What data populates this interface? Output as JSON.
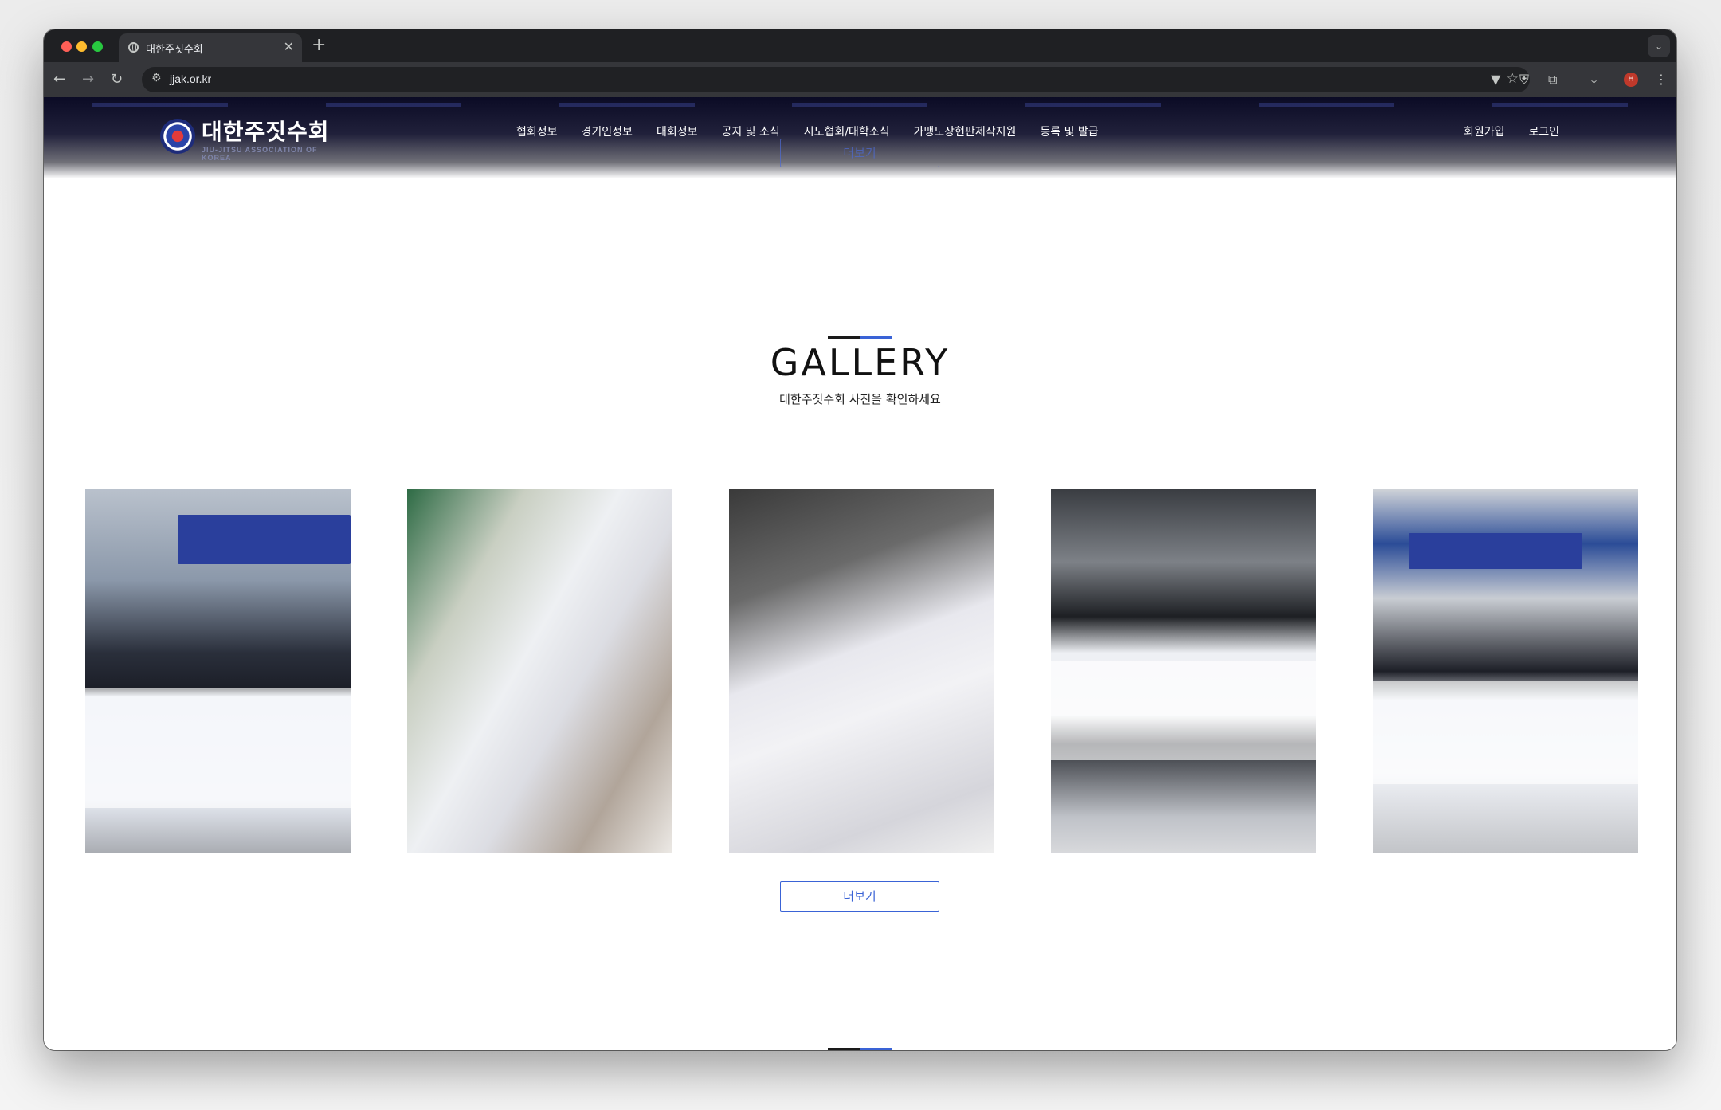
{
  "browser": {
    "tab_title": "대한주짓수회",
    "url": "jjak.or.kr",
    "profile_initial": "H"
  },
  "header": {
    "logo_text": "대한주짓수회",
    "logo_sub": "JIU-JITSU ASSOCIATION OF KOREA",
    "nav": [
      "협회정보",
      "경기인정보",
      "대회정보",
      "공지 및 소식",
      "시도협회/대학소식",
      "가맹도장현판제작지원",
      "등록 및 발급"
    ],
    "signup": "회원가입",
    "login": "로그인",
    "ghost_more_label": "더보기"
  },
  "gallery": {
    "title": "GALLERY",
    "subtitle": "대한주짓수회 사진을 확인하세요",
    "more_label": "더보기"
  },
  "colors": {
    "accent_blue": "#3a63d6",
    "header_dark": "#0b0b25"
  }
}
